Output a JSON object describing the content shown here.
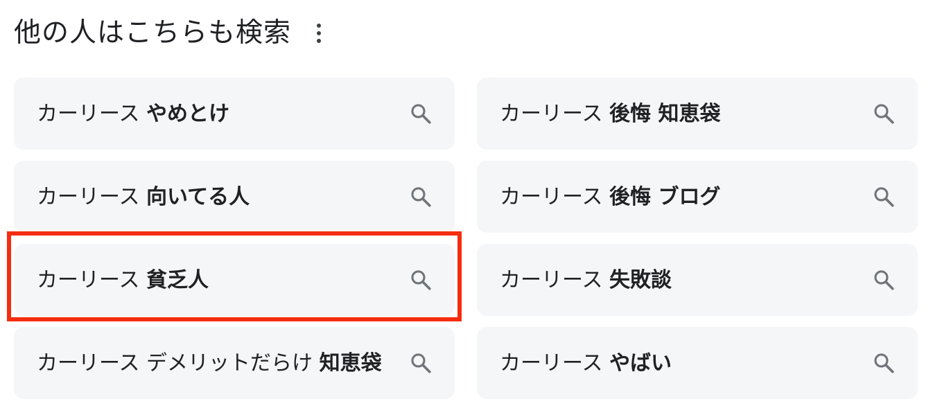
{
  "header": {
    "title": "他の人はこちらも検索",
    "more_icon": "more-vert-icon"
  },
  "colors": {
    "chip_background": "#f5f6f8",
    "text": "#202124",
    "icon": "#70757a",
    "highlight": "#f52d0f"
  },
  "suggestions": [
    {
      "prefix": "カーリース ",
      "bold": "やめとけ",
      "icon": "search-icon"
    },
    {
      "prefix": "カーリース ",
      "bold": "後悔 知恵袋",
      "icon": "search-icon"
    },
    {
      "prefix": "カーリース ",
      "bold": "向いてる人",
      "icon": "search-icon"
    },
    {
      "prefix": "カーリース ",
      "bold": "後悔 ブログ",
      "icon": "search-icon"
    },
    {
      "prefix": "カーリース ",
      "bold": "貧乏人",
      "icon": "search-icon",
      "highlighted": true
    },
    {
      "prefix": "カーリース ",
      "bold": "失敗談",
      "icon": "search-icon"
    },
    {
      "prefix": "カーリース デメリットだらけ ",
      "bold": "知恵袋",
      "icon": "search-icon"
    },
    {
      "prefix": "カーリース ",
      "bold": "やばい",
      "icon": "search-icon"
    }
  ]
}
